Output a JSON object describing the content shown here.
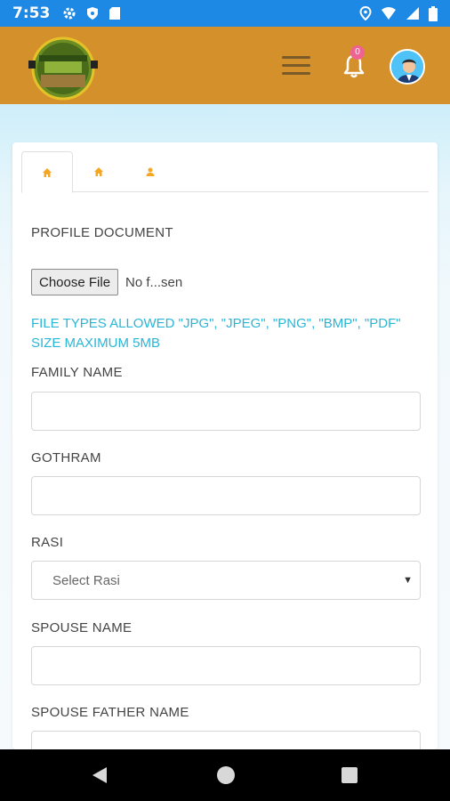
{
  "status_bar": {
    "time": "7:53"
  },
  "header": {
    "notification_count": "0"
  },
  "form": {
    "profile_document_label": "PROFILE DOCUMENT",
    "choose_file_label": "Choose File",
    "file_status": "No f...sen",
    "file_note_line1": "FILE TYPES ALLOWED \"JPG\", \"JPEG\", \"PNG\", \"BMP\", \"PDF\"",
    "file_note_line2": "SIZE MAXIMUM 5MB",
    "family_name_label": "FAMILY NAME",
    "family_name_value": "",
    "gothram_label": "GOTHRAM",
    "gothram_value": "",
    "rasi_label": "RASI",
    "rasi_selected": "Select Rasi",
    "spouse_name_label": "SPOUSE NAME",
    "spouse_name_value": "",
    "spouse_father_name_label": "SPOUSE FATHER NAME",
    "spouse_father_name_value": ""
  },
  "colors": {
    "status_bar": "#1e88e5",
    "header": "#d4902a",
    "tab_icon": "#f5a623",
    "note_text": "#29b6d6",
    "badge": "#f06292"
  },
  "icons": {
    "tab1": "home-icon",
    "tab2": "home-icon",
    "tab3": "user-icon"
  }
}
